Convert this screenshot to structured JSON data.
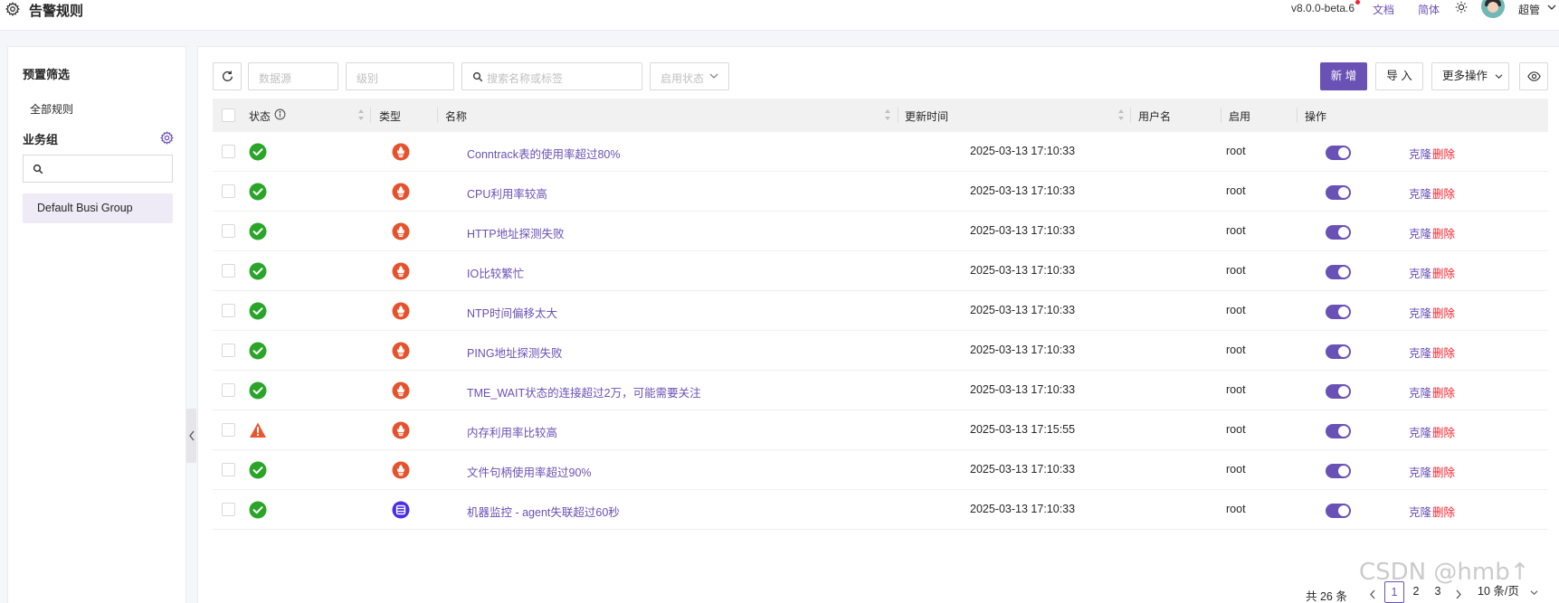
{
  "header": {
    "title": "告警规则",
    "version": "v8.0.0-beta.6",
    "doc_label": "文档",
    "lang_label": "简体",
    "user_name": "超管"
  },
  "sidebar": {
    "preset_title": "预置筛选",
    "all_rules": "全部规则",
    "group_title": "业务组",
    "search_value": "",
    "groups": [
      "Default Busi Group"
    ]
  },
  "toolbar": {
    "datasource_placeholder": "数据源",
    "level_placeholder": "级别",
    "search_placeholder": "搜索名称或标签",
    "enable_status_placeholder": "启用状态",
    "new_label": "新 增",
    "import_label": "导 入",
    "more_label": "更多操作"
  },
  "table": {
    "columns": {
      "status": "状态",
      "type": "类型",
      "name": "名称",
      "updated": "更新时间",
      "username": "用户名",
      "enabled": "启用",
      "actions": "操作"
    },
    "clone_label": "克隆",
    "delete_label": "删除",
    "rows": [
      {
        "status": "ok",
        "type": "prometheus",
        "name": "Conntrack表的使用率超过80%",
        "updated": "2025-03-13 17:10:33",
        "username": "root",
        "enabled": true
      },
      {
        "status": "ok",
        "type": "prometheus",
        "name": "CPU利用率较高",
        "updated": "2025-03-13 17:10:33",
        "username": "root",
        "enabled": true
      },
      {
        "status": "ok",
        "type": "prometheus",
        "name": "HTTP地址探测失败",
        "updated": "2025-03-13 17:10:33",
        "username": "root",
        "enabled": true
      },
      {
        "status": "ok",
        "type": "prometheus",
        "name": "IO比较繁忙",
        "updated": "2025-03-13 17:10:33",
        "username": "root",
        "enabled": true
      },
      {
        "status": "ok",
        "type": "prometheus",
        "name": "NTP时间偏移太大",
        "updated": "2025-03-13 17:10:33",
        "username": "root",
        "enabled": true
      },
      {
        "status": "ok",
        "type": "prometheus",
        "name": "PING地址探测失败",
        "updated": "2025-03-13 17:10:33",
        "username": "root",
        "enabled": true
      },
      {
        "status": "ok",
        "type": "prometheus",
        "name": "TME_WAIT状态的连接超过2万，可能需要关注",
        "updated": "2025-03-13 17:10:33",
        "username": "root",
        "enabled": true
      },
      {
        "status": "warning",
        "type": "prometheus",
        "name": "内存利用率比较高",
        "updated": "2025-03-13 17:15:55",
        "username": "root",
        "enabled": true
      },
      {
        "status": "ok",
        "type": "prometheus",
        "name": "文件句柄使用率超过90%",
        "updated": "2025-03-13 17:10:33",
        "username": "root",
        "enabled": true
      },
      {
        "status": "ok",
        "type": "host",
        "name": "机器监控 - agent失联超过60秒",
        "updated": "2025-03-13 17:10:33",
        "username": "root",
        "enabled": true
      }
    ]
  },
  "pagination": {
    "total_label": "共 26 条",
    "pages": [
      "1",
      "2",
      "3"
    ],
    "current_page": "1",
    "page_size_label": "10 条/页"
  },
  "watermark": "CSDN @hmb↑",
  "colors": {
    "primary": "#6a51b5",
    "ok": "#2aa52a",
    "warning": "#e8582e",
    "prometheus": "#e6522c",
    "host": "#4a2ee8",
    "danger": "#f5222d"
  }
}
